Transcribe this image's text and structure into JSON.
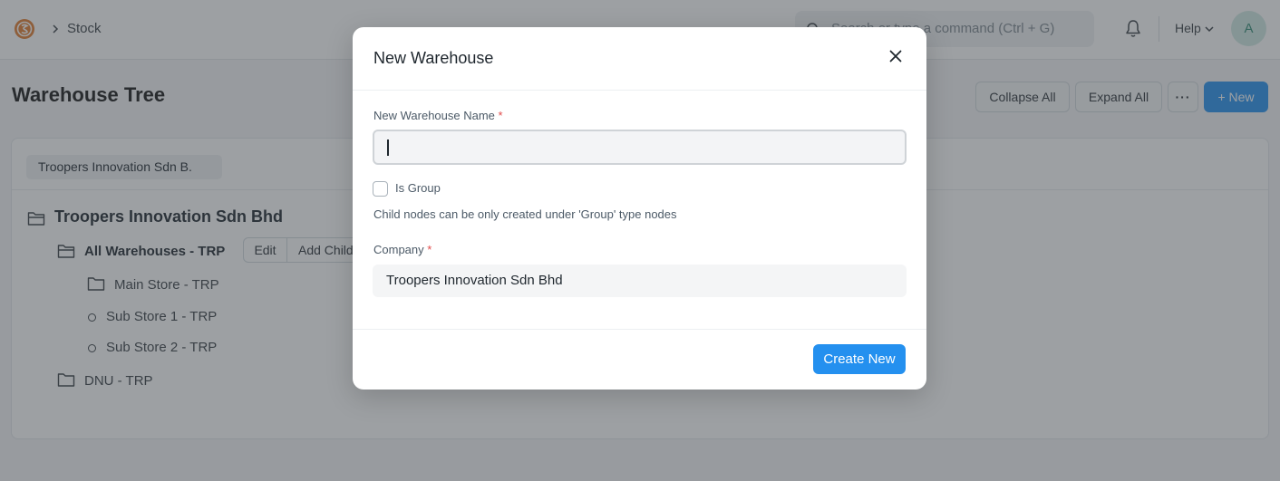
{
  "navbar": {
    "breadcrumb": "Stock",
    "search_placeholder": "Search or type a command (Ctrl + G)",
    "help_label": "Help",
    "avatar_initial": "A"
  },
  "page": {
    "title": "Warehouse Tree",
    "buttons": {
      "collapse_all": "Collapse All",
      "expand_all": "Expand All",
      "more": "···",
      "new": "+ New"
    }
  },
  "tree": {
    "company_filter": "Troopers Innovation Sdn B.",
    "root": "Troopers Innovation Sdn Bhd",
    "nodes": [
      {
        "label": "All Warehouses - TRP",
        "is_group": true
      },
      {
        "label": "Main Store - TRP",
        "is_group": true
      },
      {
        "label": "Sub Store 1 - TRP",
        "is_group": false
      },
      {
        "label": "Sub Store 2 - TRP",
        "is_group": false
      },
      {
        "label": "DNU - TRP",
        "is_group": true
      }
    ],
    "node_actions": {
      "edit": "Edit",
      "add_child": "Add Child"
    }
  },
  "modal": {
    "title": "New Warehouse",
    "name_label": "New Warehouse Name",
    "required_mark": "*",
    "name_value": "",
    "is_group_label": "Is Group",
    "is_group_checked": false,
    "help_text": "Child nodes can be only created under 'Group' type nodes",
    "company_label": "Company",
    "company_value": "Troopers Innovation Sdn Bhd",
    "create_button": "Create New"
  },
  "colors": {
    "primary": "#2490ef",
    "required": "#e24c4c",
    "avatar_bg": "#cfe9e2",
    "avatar_text": "#318a74"
  }
}
